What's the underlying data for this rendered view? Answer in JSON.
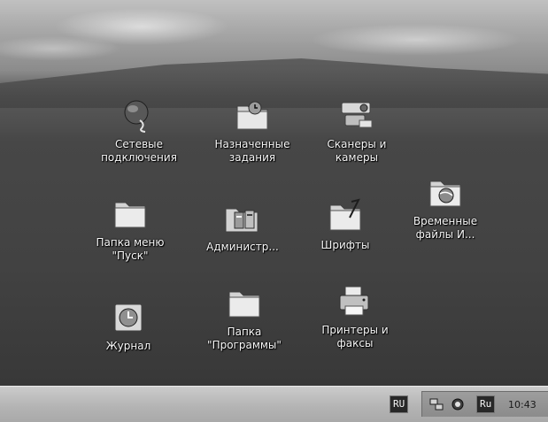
{
  "desktop": {
    "icons": [
      {
        "label": "Сетевые\nподключения",
        "icon": "network-connections-icon"
      },
      {
        "label": "Назначенные\nзадания",
        "icon": "scheduled-tasks-icon"
      },
      {
        "label": "Сканеры и\nкамеры",
        "icon": "scanners-cameras-icon"
      },
      {
        "label": "Папка меню\n\"Пуск\"",
        "icon": "start-menu-folder-icon"
      },
      {
        "label": "Администр...",
        "icon": "administrative-tools-icon"
      },
      {
        "label": "Шрифты",
        "icon": "fonts-folder-icon"
      },
      {
        "label": "Временные\nфайлы И...",
        "icon": "temporary-internet-files-icon"
      },
      {
        "label": "Журнал",
        "icon": "history-icon"
      },
      {
        "label": "Папка\n\"Программы\"",
        "icon": "programs-folder-icon"
      },
      {
        "label": "Принтеры и\nфаксы",
        "icon": "printers-faxes-icon"
      }
    ]
  },
  "taskbar": {
    "language_indicator": "RU",
    "tray": {
      "icons": [
        "network-tray-icon",
        "security-tray-icon"
      ],
      "language_badge": "Ru",
      "clock": "10:43"
    }
  }
}
